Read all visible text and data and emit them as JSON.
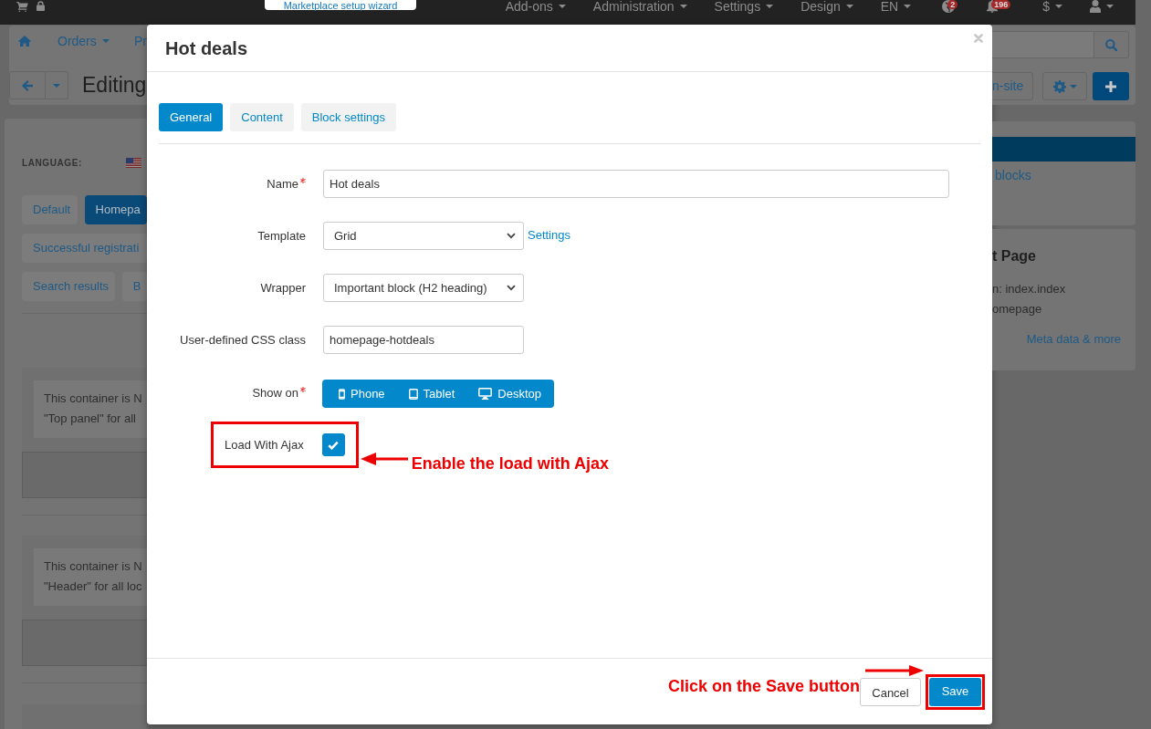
{
  "top_bar": {
    "wizard_button": "Marketplace setup wizard",
    "menus": [
      {
        "label": "Add-ons",
        "caret": true
      },
      {
        "label": "Administration",
        "caret": true
      },
      {
        "label": "Settings",
        "caret": true
      },
      {
        "label": "Design",
        "caret": true
      },
      {
        "label": "EN",
        "caret": true
      }
    ],
    "alerts": [
      {
        "kind": "globe",
        "badge": "2"
      },
      {
        "kind": "bell",
        "badge": "196"
      }
    ],
    "currency": "$"
  },
  "nav": {
    "items": [
      {
        "label": "Orders",
        "caret": true
      },
      {
        "label": "Pr",
        "caret": false
      }
    ]
  },
  "toolbar": {
    "title": "Editing",
    "site_button": "n-site"
  },
  "language": {
    "label": "LANGUAGE:"
  },
  "layout_tabs": [
    {
      "label": "Default",
      "selected": false
    },
    {
      "label": "Homepa",
      "selected": true
    },
    {
      "label": "Successful registrati",
      "selected": false
    },
    {
      "label": "Search results",
      "selected": false
    },
    {
      "label": "B",
      "selected": false
    }
  ],
  "containers": [
    {
      "text_lines": [
        "This container is N",
        "\"Top panel\" for all"
      ]
    },
    {
      "text_lines": [
        "This container is N",
        "\"Header\" for all loc"
      ]
    }
  ],
  "sidebar": {
    "link": "blocks",
    "page_title": "t Page",
    "lines": [
      "n: index.index",
      "omepage"
    ],
    "more_link": "Meta data & more"
  },
  "modal": {
    "title": "Hot deals",
    "tabs": [
      {
        "label": "General",
        "selected": true
      },
      {
        "label": "Content",
        "selected": false
      },
      {
        "label": "Block settings",
        "selected": false
      }
    ],
    "fields": [
      {
        "kind": "wide_text",
        "label": "Name",
        "required": true,
        "value": "Hot deals"
      },
      {
        "kind": "select",
        "label": "Template",
        "required": false,
        "value": "Grid",
        "link": "Settings"
      },
      {
        "kind": "select",
        "label": "Wrapper",
        "required": false,
        "value": "Important block (H2 heading)"
      },
      {
        "kind": "text",
        "label": "User-defined CSS class",
        "required": false,
        "value": "homepage-hotdeals"
      },
      {
        "kind": "devices",
        "label": "Show on",
        "required": true,
        "options": [
          {
            "kind": "phone",
            "label": "Phone",
            "selected": true
          },
          {
            "kind": "tablet",
            "label": "Tablet",
            "selected": true
          },
          {
            "kind": "desktop",
            "label": "Desktop",
            "selected": true
          }
        ]
      },
      {
        "kind": "checkbox",
        "label": "Load With Ajax",
        "required": false,
        "checked": true,
        "highlighted": true,
        "callout": "Enable the load with Ajax"
      }
    ],
    "footer": {
      "cancel": "Cancel",
      "save": "Save",
      "save_highlighted": true,
      "save_callout": "Click on the Save button"
    }
  }
}
